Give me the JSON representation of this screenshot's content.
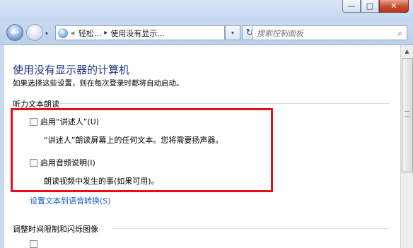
{
  "window": {
    "min_glyph": "—",
    "max_glyph": "□",
    "close_glyph": "✕"
  },
  "nav": {
    "back_glyph": "←",
    "fwd_glyph": "→",
    "address": {
      "prefix": "«",
      "crumb1": "轻松...",
      "sep": "▸",
      "crumb2": "使用没有显示..."
    },
    "dropdown_glyph": "▾",
    "refresh_glyph": "↻",
    "search": {
      "placeholder": "搜索控制面板",
      "icon": "search-icon"
    }
  },
  "main": {
    "title": "使用没有显示器的计算机",
    "subtitle": "如果选择这些设置，则在每次登录时都将自动启动。",
    "section1": {
      "heading": "听力文本朗读",
      "option1": {
        "label": "启用“讲述人”(U)",
        "checked": false,
        "description": "“讲述人”朗读屏幕上的任何文本。您将需要扬声器。"
      },
      "option2": {
        "label": "启用音频说明(I)",
        "checked": false,
        "description": "朗读视频中发生的事(如果可用)。"
      },
      "link": "设置文本到语音转换(S)"
    },
    "section2": {
      "heading": "调整时间限制和闪烁图像"
    }
  },
  "colors": {
    "title": "#1e3287",
    "link": "#1660c4",
    "highlight": "#e2101b"
  }
}
